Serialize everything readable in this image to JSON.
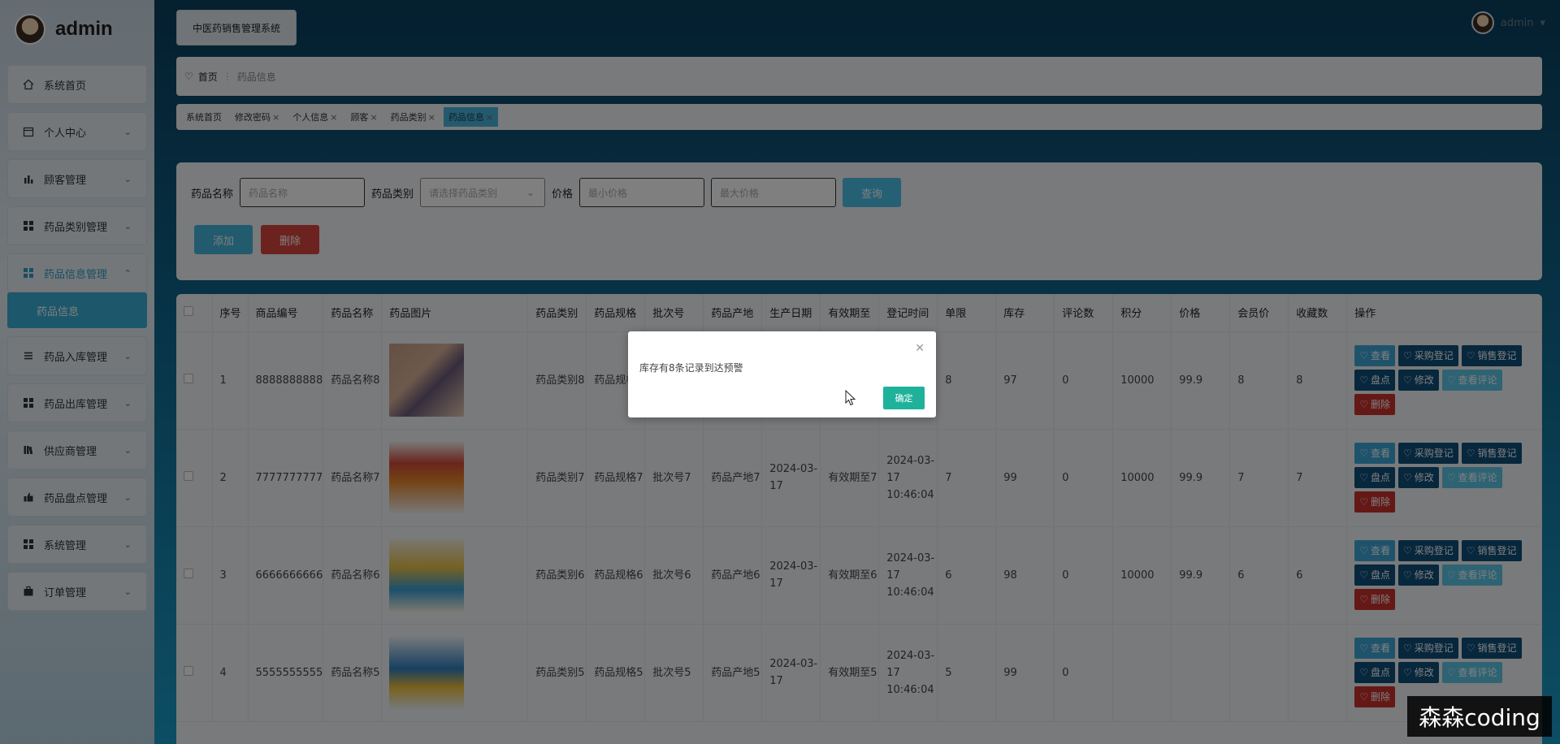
{
  "sidebar": {
    "brand": "admin",
    "items": [
      {
        "label": "系统首页",
        "icon": "home-icon"
      },
      {
        "label": "个人中心",
        "icon": "calendar-icon"
      },
      {
        "label": "顾客管理",
        "icon": "bar-chart-icon"
      },
      {
        "label": "药品类别管理",
        "icon": "grid-icon"
      },
      {
        "label": "药品信息管理",
        "icon": "grid-icon"
      },
      {
        "label": "药品入库管理",
        "icon": "list-icon"
      },
      {
        "label": "药品出库管理",
        "icon": "grid-icon"
      },
      {
        "label": "供应商管理",
        "icon": "books-icon"
      },
      {
        "label": "药品盘点管理",
        "icon": "thumbs-up-icon"
      },
      {
        "label": "系统管理",
        "icon": "grid-icon"
      },
      {
        "label": "订单管理",
        "icon": "briefcase-icon"
      }
    ],
    "submenu_label": "药品信息"
  },
  "header": {
    "system_title": "中医药销售管理系统",
    "user": "admin"
  },
  "breadcrumb": {
    "home": "首页",
    "current": "药品信息"
  },
  "tabs": [
    {
      "label": "系统首页",
      "closable": false
    },
    {
      "label": "修改密码",
      "closable": true
    },
    {
      "label": "个人信息",
      "closable": true
    },
    {
      "label": "顾客",
      "closable": true
    },
    {
      "label": "药品类别",
      "closable": true
    },
    {
      "label": "药品信息",
      "closable": true
    }
  ],
  "search": {
    "name_label": "药品名称",
    "name_placeholder": "药品名称",
    "category_label": "药品类别",
    "category_placeholder": "请选择药品类别",
    "price_label": "价格",
    "min_price_placeholder": "最小价格",
    "max_price_placeholder": "最大价格",
    "query_button": "查询",
    "add_button": "添加",
    "delete_button": "删除"
  },
  "table": {
    "headers": [
      "序号",
      "商品编号",
      "药品名称",
      "药品图片",
      "药品类别",
      "药品规格",
      "批次号",
      "药品产地",
      "生产日期",
      "有效期至",
      "登记时间",
      "单限",
      "库存",
      "评论数",
      "积分",
      "价格",
      "会员价",
      "收藏数",
      "操作"
    ],
    "rows": [
      {
        "idx": "1",
        "code": "8888888888",
        "name": "药品名称8",
        "category": "药品类别8",
        "spec": "药品规格8",
        "batch": "",
        "origin": "",
        "prod_date": "",
        "expiry": "",
        "reg_time": "",
        "limit": "8",
        "stock": "97",
        "comments": "0",
        "points": "10000",
        "price": "99.9",
        "member_price": "8",
        "favorites": "8"
      },
      {
        "idx": "2",
        "code": "7777777777",
        "name": "药品名称7",
        "category": "药品类别7",
        "spec": "药品规格7",
        "batch": "批次号7",
        "origin": "药品产地7",
        "prod_date": "2024-03-17",
        "expiry": "有效期至7",
        "reg_time": "2024-03-17 10:46:04",
        "limit": "7",
        "stock": "99",
        "comments": "0",
        "points": "10000",
        "price": "99.9",
        "member_price": "7",
        "favorites": "7"
      },
      {
        "idx": "3",
        "code": "6666666666",
        "name": "药品名称6",
        "category": "药品类别6",
        "spec": "药品规格6",
        "batch": "批次号6",
        "origin": "药品产地6",
        "prod_date": "2024-03-17",
        "expiry": "有效期至6",
        "reg_time": "2024-03-17 10:46:04",
        "limit": "6",
        "stock": "98",
        "comments": "0",
        "points": "10000",
        "price": "99.9",
        "member_price": "6",
        "favorites": "6"
      },
      {
        "idx": "4",
        "code": "5555555555",
        "name": "药品名称5",
        "category": "药品类别5",
        "spec": "药品规格5",
        "batch": "批次号5",
        "origin": "药品产地5",
        "prod_date": "2024-03-17",
        "expiry": "有效期至5",
        "reg_time": "2024-03-17 10:46:04",
        "limit": "5",
        "stock": "99",
        "comments": "0",
        "points": "",
        "price": "",
        "member_price": "",
        "favorites": ""
      }
    ],
    "ops": {
      "view": "查看",
      "purchase": "采购登记",
      "sale": "销售登记",
      "inventory": "盘点",
      "edit": "修改",
      "comments": "查看评论",
      "delete": "删除"
    }
  },
  "modal": {
    "message": "库存有8条记录到达预警",
    "confirm": "确定"
  },
  "watermark": "森森coding",
  "colors": {
    "accent": "#3aaed6",
    "danger": "#c8322d",
    "confirm": "#1fb29b",
    "dark_button": "#0e4e7a"
  }
}
